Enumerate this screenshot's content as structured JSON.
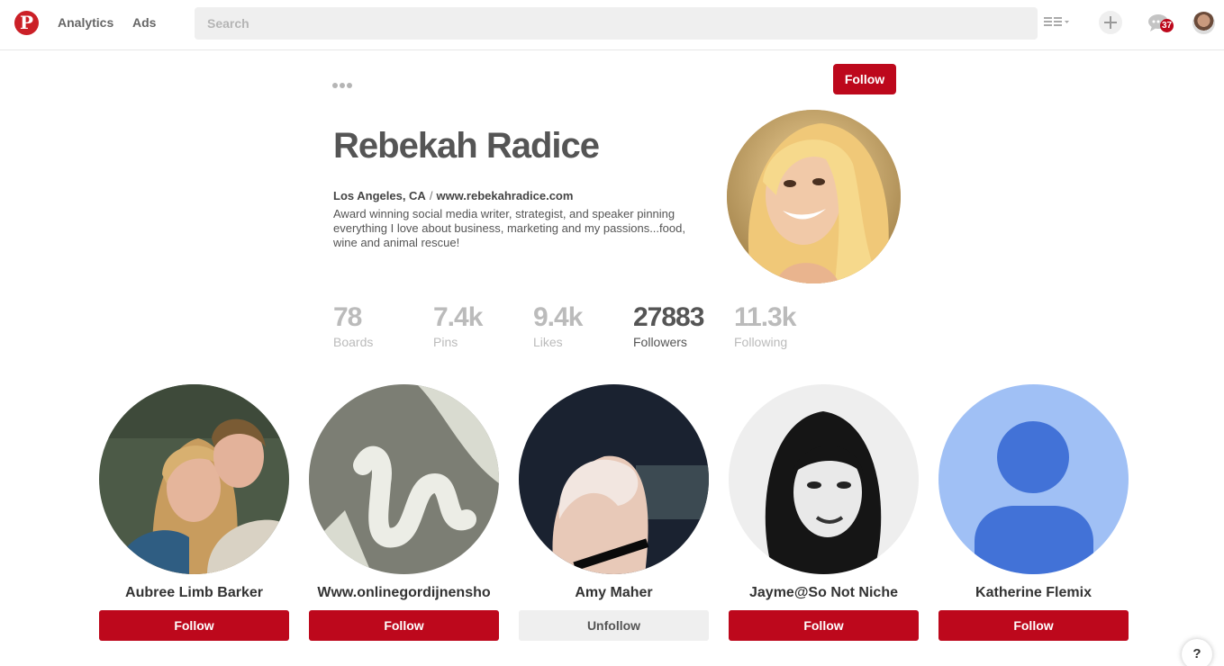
{
  "nav": {
    "analytics": "Analytics",
    "ads": "Ads",
    "search_placeholder": "Search",
    "notification_count": "37"
  },
  "colors": {
    "brand": "#bd081c",
    "muted": "#bbbbbb",
    "search_bg": "#efefef"
  },
  "icons": {
    "logo": "pinterest-logo-icon",
    "more": "more-icon",
    "grid": "grid-view-icon",
    "plus": "plus-icon",
    "messages": "messages-icon"
  },
  "profile": {
    "name": "Rebekah Radice",
    "location": "Los Angeles, CA",
    "separator": "/",
    "website": "www.rebekahradice.com",
    "bio": "Award winning social media writer, strategist, and speaker pinning everything I love about business, marketing and my passions...food, wine and animal rescue!",
    "follow_label": "Follow"
  },
  "stats": [
    {
      "value": "78",
      "label": "Boards"
    },
    {
      "value": "7.4k",
      "label": "Pins"
    },
    {
      "value": "9.4k",
      "label": "Likes"
    },
    {
      "value": "27883",
      "label": "Followers"
    },
    {
      "value": "11.3k",
      "label": "Following"
    }
  ],
  "followers": [
    {
      "name": "Aubree Limb Barker",
      "button": "Follow"
    },
    {
      "name": "Www.onlinegordijnensho",
      "button": "Follow"
    },
    {
      "name": "Amy Maher",
      "button": "Unfollow"
    },
    {
      "name": "Jayme@So Not Niche",
      "button": "Follow"
    },
    {
      "name": "Katherine Flemix",
      "button": "Follow"
    }
  ],
  "help_label": "?"
}
